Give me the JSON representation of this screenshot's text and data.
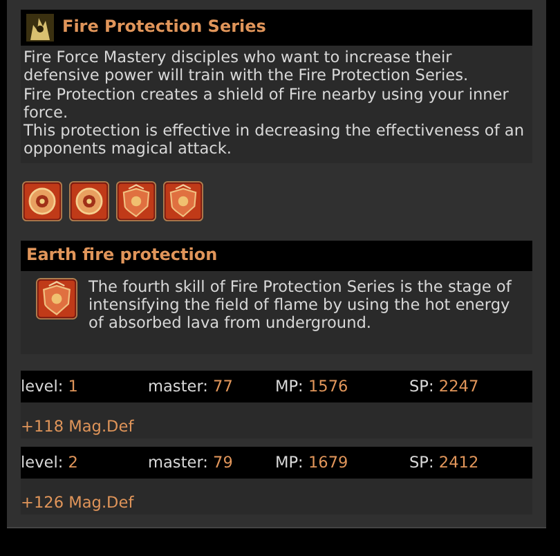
{
  "series": {
    "title": "Fire Protection Series",
    "description": [
      "Fire Force Mastery disciples who want to increase their defensive power will train with the Fire Protection Series.",
      "Fire Protection creates a shield of Fire nearby using your inner force.",
      "This protection is effective in decreasing the effectiveness of an opponents magical attack."
    ],
    "skill_icons": [
      {
        "kind": "round"
      },
      {
        "kind": "round"
      },
      {
        "kind": "shield"
      },
      {
        "kind": "shield"
      }
    ]
  },
  "skill": {
    "title": "Earth fire protection",
    "icon": {
      "kind": "shield"
    },
    "description": "The fourth skill of Fire Protection Series is the stage of intensifying the field of flame by using the hot energy of absorbed lava from underground."
  },
  "levels": [
    {
      "stats": [
        {
          "label": "level:",
          "value": "1"
        },
        {
          "label": "master:",
          "value": "77"
        },
        {
          "label": "MP:",
          "value": "1576"
        },
        {
          "label": "SP:",
          "value": "2247"
        }
      ],
      "bonus": "+118 Mag.Def"
    },
    {
      "stats": [
        {
          "label": "level:",
          "value": "2"
        },
        {
          "label": "master:",
          "value": "79"
        },
        {
          "label": "MP:",
          "value": "1679"
        },
        {
          "label": "SP:",
          "value": "2412"
        }
      ],
      "bonus": "+126 Mag.Def"
    }
  ]
}
